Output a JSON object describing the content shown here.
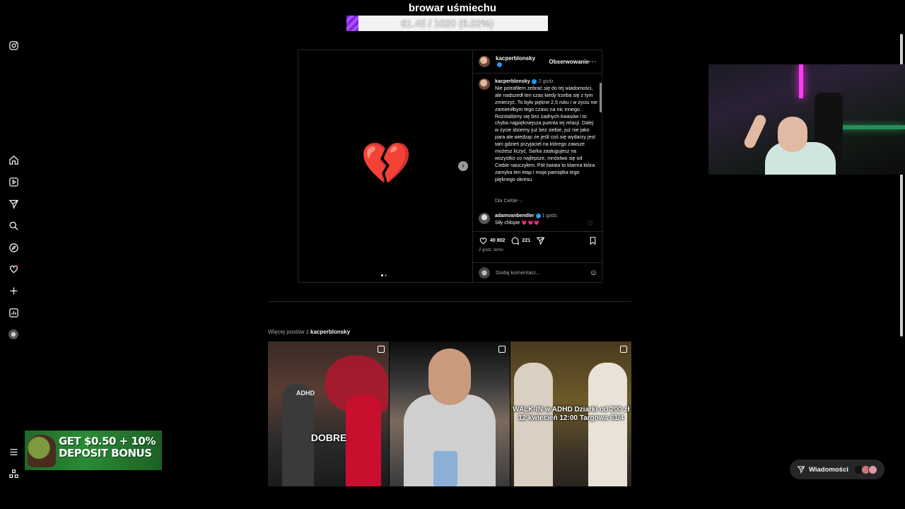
{
  "stream": {
    "title": "browar uśmiechu",
    "goal_text": "61.45 / 1020 (6.02%)",
    "goal_progress": 0.0602
  },
  "sidebar": {
    "items": [
      "instagram-logo",
      "home",
      "reels",
      "messages",
      "search",
      "explore",
      "notifications",
      "create",
      "dashboard",
      "profile",
      "more",
      "meta-apps"
    ]
  },
  "post": {
    "author": "kacperblonsky",
    "follow_label": "Obserwowanie",
    "more_label": "···",
    "media_emoji": "💔",
    "caption_author": "kacperblonsky",
    "caption_time": "2 godz.",
    "caption_text": "Nie potrafiłem zebrać się do tej wiadomości, ale nadszedł ten czas kiedy trzeba się z tym zmierzyć. To było piękne 2,5 roku i w życiu nie zamieniłbym tego czasu na nic innego. Rozstaliśmy się bez żadnych kwasów i to chyba najpiękniejsza puenta tej relacji. Dalej w życie idziemy już bez siebie, już nie jako para ale wiedząc że jeśli coś się wydarzy jest tam gdzieś przyjaciel na którego zawsze możesz liczyć. Sarka zasługujesz na wszystko co najlepsze, mnóstwo się od Ciebie nauczyłem. Pół świata to klamra która zamyka ten etap i moja pamiątka tego pięknego okresu.",
    "for_you_label": "Dla Ciebie",
    "comment_author": "adamvanbendler",
    "comment_time": "1 godz.",
    "comment_text": "Siły chłopie 💗💗💗",
    "likes": "40 802",
    "comments_count": "221",
    "ago": "2 godz. temu",
    "add_comment_placeholder": "Dodaj komentarz..."
  },
  "more_posts": {
    "label_prefix": "Więcej postów z",
    "label_user": "kacperblonsky",
    "tiles": [
      {
        "overlay": "DOBRE",
        "wordmark": "ADHD"
      },
      {
        "overlay": ""
      },
      {
        "overlay": "WALK-IN w ADHD Dziarki od 200 zł 12 kwiecień 12:00 Targowa 61/4"
      }
    ]
  },
  "messages_button": {
    "label": "Wiadomości"
  },
  "banner": {
    "text": "GET $0.50 + 10% DEPOSIT BONUS"
  },
  "colors": {
    "goal_fill": "#8a35e0",
    "verified": "#1d9bf0",
    "banner_bg": "#2a8a34"
  }
}
